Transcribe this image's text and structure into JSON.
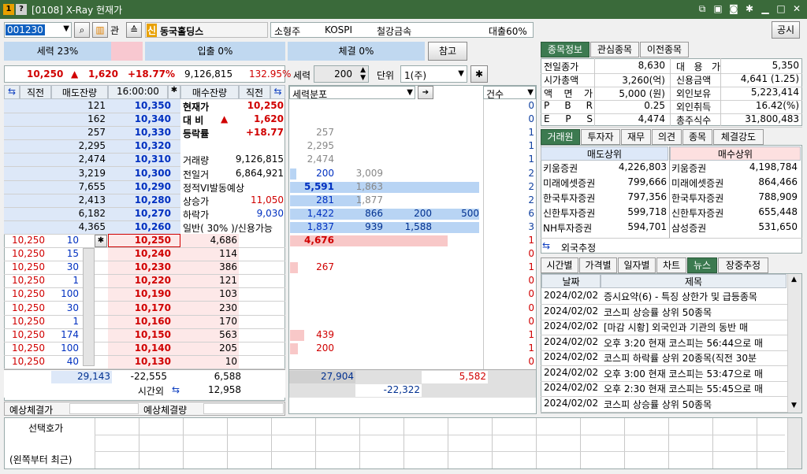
{
  "window": {
    "badge1": "1",
    "badge2": "?",
    "title": "[0108] X-Ray 현재가"
  },
  "header": {
    "code": "001230",
    "kwan": "관",
    "name_prefix": "신",
    "name": "동국홀딩스",
    "size": "소형주",
    "market": "KOSPI",
    "sector": "철강금속",
    "loan": "대출60%",
    "notice": "공시"
  },
  "strength_bar": {
    "strength": "세력 23%",
    "inflow": "입출 0%",
    "exec": "체결 0%",
    "ref": "참고"
  },
  "price_line": {
    "price": "10,250",
    "arrow": "▲",
    "change": "1,620",
    "rate": "+18.77%",
    "volume": "9,126,815",
    "ratio": "132.95%"
  },
  "controls": {
    "strength_label": "세력",
    "strength_val": "200",
    "unit_label": "단위",
    "unit_val": "1(주)"
  },
  "orderbook": {
    "headers": {
      "direct": "직전",
      "ask_qty": "매도잔량",
      "time": "16:00:00",
      "bid_qty": "매수잔량",
      "direct2": "직전"
    },
    "asks": [
      {
        "qty": "121",
        "price": "10,350"
      },
      {
        "qty": "162",
        "price": "10,340"
      },
      {
        "qty": "257",
        "price": "10,330"
      },
      {
        "qty": "2,295",
        "price": "10,320"
      },
      {
        "qty": "2,474",
        "price": "10,310"
      },
      {
        "qty": "3,219",
        "price": "10,300"
      },
      {
        "qty": "7,655",
        "price": "10,290"
      },
      {
        "qty": "2,413",
        "price": "10,280"
      },
      {
        "qty": "6,182",
        "price": "10,270"
      },
      {
        "qty": "4,365",
        "price": "10,260"
      }
    ],
    "bids": [
      {
        "prev": "10,250",
        "q": "10",
        "price": "10,250",
        "qty": "4,686"
      },
      {
        "prev": "10,250",
        "q": "15",
        "price": "10,240",
        "qty": "114"
      },
      {
        "prev": "10,250",
        "q": "30",
        "price": "10,230",
        "qty": "386"
      },
      {
        "prev": "10,250",
        "q": "1",
        "price": "10,220",
        "qty": "121"
      },
      {
        "prev": "10,250",
        "q": "100",
        "price": "10,190",
        "qty": "103"
      },
      {
        "prev": "10,250",
        "q": "30",
        "price": "10,170",
        "qty": "230"
      },
      {
        "prev": "10,250",
        "q": "1",
        "price": "10,160",
        "qty": "170"
      },
      {
        "prev": "10,250",
        "q": "174",
        "price": "10,150",
        "qty": "563"
      },
      {
        "prev": "10,250",
        "q": "100",
        "price": "10,140",
        "qty": "205"
      },
      {
        "prev": "10,250",
        "q": "40",
        "price": "10,130",
        "qty": "10"
      }
    ],
    "info": [
      {
        "label": "현재가",
        "value": "10,250"
      },
      {
        "label": "대 비",
        "arrow": "▲",
        "value": "1,620"
      },
      {
        "label": "등락률",
        "value": "+18.77"
      },
      {
        "label": "",
        "value": ""
      },
      {
        "label": "거래량",
        "value": "9,126,815"
      },
      {
        "label": "전일거",
        "value": "6,864,921"
      },
      {
        "label": "정적VI발동예상",
        "value": ""
      },
      {
        "label": "상승가",
        "value": "11,050"
      },
      {
        "label": "하락가",
        "value": "9,030"
      },
      {
        "label": "일반( 30% )/신용가능",
        "value": ""
      }
    ],
    "totals": {
      "ask_total": "29,143",
      "diff": "-22,555",
      "bid_total": "6,588",
      "after_label": "시간외",
      "after_val": "12,958"
    },
    "expect": {
      "price_label": "예상체결가",
      "qty_label": "예상체결량"
    }
  },
  "dist": {
    "header": "세력분포",
    "count_header": "건수",
    "ask_rows": [
      {
        "a": "",
        "b": "",
        "n": "0"
      },
      {
        "a": "",
        "b": "",
        "n": "0"
      },
      {
        "a": "257",
        "b": "",
        "n": "1"
      },
      {
        "a": "2,295",
        "b": "",
        "n": "1"
      },
      {
        "a": "2,474",
        "b": "",
        "n": "1"
      },
      {
        "a": "200",
        "b": "3,009",
        "n": "2"
      },
      {
        "a": "5,591",
        "b": "1,863",
        "n": "2"
      },
      {
        "a": "281",
        "b": "1,877",
        "n": "2"
      },
      {
        "a": "1,422",
        "b": "866",
        "c": "200",
        "d": "500",
        "n": "6"
      },
      {
        "a": "1,837",
        "b": "939",
        "c": "1,588",
        "n": "3"
      }
    ],
    "bid_rows": [
      {
        "a": "4,676",
        "n": "1"
      },
      {
        "a": "",
        "n": "0"
      },
      {
        "a": "267",
        "n": "1"
      },
      {
        "a": "",
        "n": "0"
      },
      {
        "a": "",
        "n": "0"
      },
      {
        "a": "",
        "n": "0"
      },
      {
        "a": "",
        "n": "0"
      },
      {
        "a": "439",
        "n": "1"
      },
      {
        "a": "200",
        "n": "1"
      },
      {
        "a": "",
        "n": "0"
      }
    ],
    "totals": {
      "ask": "27,904",
      "bid": "5,582",
      "diff": "-22,322"
    }
  },
  "stockinfo": {
    "tabs": [
      "종목정보",
      "관심종목",
      "이전종목"
    ],
    "rows": [
      {
        "l1": "전일종가",
        "v1": "8,630",
        "l2": "대 용 가",
        "v2": "5,350"
      },
      {
        "l1": "시가총액",
        "v1": "3,260(억)",
        "l2": "신용금액",
        "v2": "4,641 (1.25)"
      },
      {
        "l1": "액 면 가",
        "v1": "5,000 (원)",
        "l2": "외인보유",
        "v2": "5,223,414"
      },
      {
        "l1": "P B R",
        "v1": "0.25",
        "l2": "외인취득",
        "v2": "16.42(%)"
      },
      {
        "l1": "E P S",
        "v1": "4,474",
        "l2": "총주식수",
        "v2": "31,800,483"
      }
    ]
  },
  "broker": {
    "tabs": [
      "거래원",
      "투자자",
      "재무",
      "의견",
      "종목",
      "체결강도"
    ],
    "sell_header": "매도상위",
    "buy_header": "매수상위",
    "rows": [
      {
        "s": "키움증권",
        "sv": "4,226,803",
        "b": "키움증권",
        "bv": "4,198,784"
      },
      {
        "s": "미래에셋증권",
        "sv": "799,666",
        "b": "미래에셋증권",
        "bv": "864,466"
      },
      {
        "s": "한국투자증권",
        "sv": "797,356",
        "b": "한국투자증권",
        "bv": "788,909"
      },
      {
        "s": "신한투자증권",
        "sv": "599,718",
        "b": "신한투자증권",
        "bv": "655,448"
      },
      {
        "s": "NH투자증권",
        "sv": "594,701",
        "b": "삼성증권",
        "bv": "531,650"
      }
    ],
    "foreign": "외국추정"
  },
  "news": {
    "tabs": [
      "시간별",
      "가격별",
      "일자별",
      "차트",
      "뉴스",
      "장중추정"
    ],
    "headers": {
      "date": "날짜",
      "title": "제목"
    },
    "rows": [
      {
        "d": "2024/02/02",
        "t": "증시요약(6) - 특징 상한가 및 급등종목"
      },
      {
        "d": "2024/02/02",
        "t": "코스피 상승률 상위 50종목"
      },
      {
        "d": "2024/02/02",
        "t": "[마감 시황] 외국인과 기관의 동반 매"
      },
      {
        "d": "2024/02/02",
        "t": "오후 3:20 현재 코스피는 56:44으로 매"
      },
      {
        "d": "2024/02/02",
        "t": "코스피 하락률 상위 20종목(직전 30분"
      },
      {
        "d": "2024/02/02",
        "t": "오후 3:00 현재 코스피는 53:47으로 매"
      },
      {
        "d": "2024/02/02",
        "t": "오후 2:30 현재 코스피는 55:45으로 매"
      },
      {
        "d": "2024/02/02",
        "t": "코스피 상승률 상위 50종목"
      }
    ]
  },
  "bottom": {
    "select_label": "선택호가",
    "recent_label": "(왼쪽부터 최근)"
  }
}
